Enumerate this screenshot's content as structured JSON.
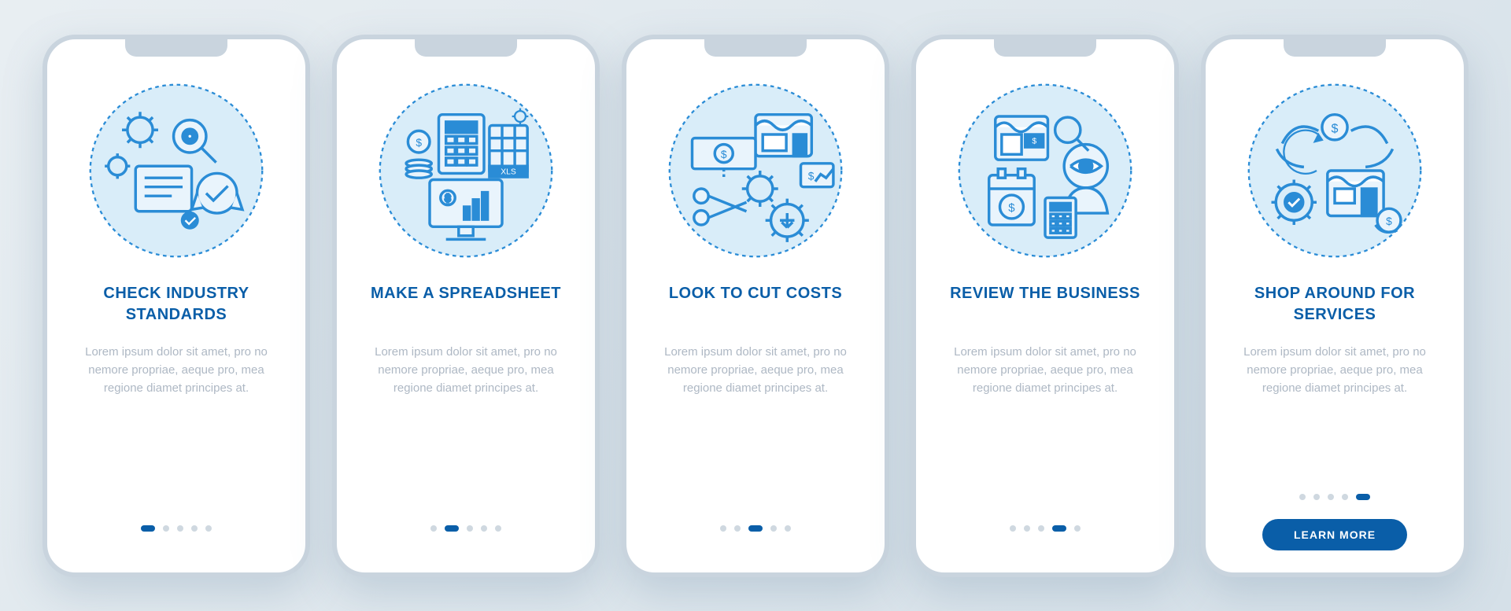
{
  "slides": [
    {
      "title": "CHECK INDUSTRY STANDARDS",
      "body": "Lorem ipsum dolor sit amet, pro no nemore propriae, aeque pro, mea regione diamet principes at.",
      "icon": "standards-icon"
    },
    {
      "title": "MAKE A SPREADSHEET",
      "body": "Lorem ipsum dolor sit amet, pro no nemore propriae, aeque pro, mea regione diamet principes at.",
      "icon": "spreadsheet-icon"
    },
    {
      "title": "LOOK TO CUT COSTS",
      "body": "Lorem ipsum dolor sit amet, pro no nemore propriae, aeque pro, mea regione diamet principes at.",
      "icon": "cut-costs-icon"
    },
    {
      "title": "REVIEW THE BUSINESS",
      "body": "Lorem ipsum dolor sit amet, pro no nemore propriae, aeque pro, mea regione diamet principes at.",
      "icon": "review-icon"
    },
    {
      "title": "SHOP AROUND FOR SERVICES",
      "body": "Lorem ipsum dolor sit amet, pro no nemore propriae, aeque pro, mea regione diamet principes at.",
      "icon": "shop-icon"
    }
  ],
  "cta_label": "LEARN MORE",
  "total_dots": 5
}
